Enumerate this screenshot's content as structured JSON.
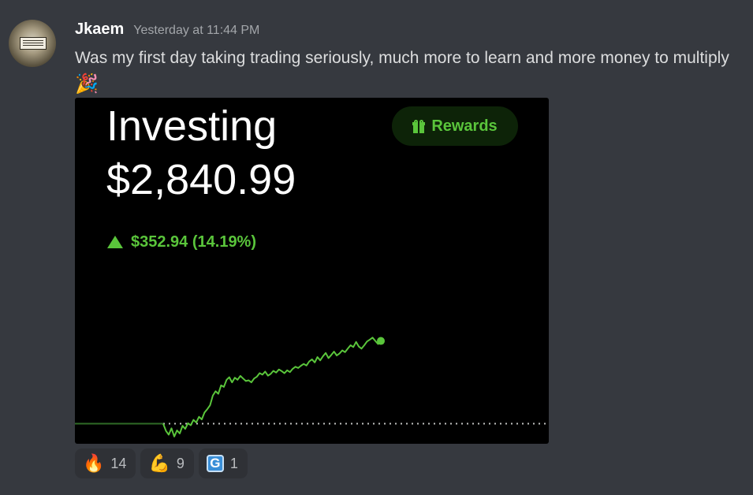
{
  "message": {
    "username": "Jkaem",
    "timestamp": "Yesterday at 11:44 PM",
    "text": "Was my first day taking trading seriously, much more to learn and more money to multiply",
    "emoji": "🎉"
  },
  "attachment": {
    "title": "Investing",
    "value": "$2,840.99",
    "change": "$352.94 (14.19%)",
    "rewards_label": "Rewards",
    "accent_color": "#5ac53b"
  },
  "chart_data": {
    "type": "line",
    "title": "",
    "xlabel": "",
    "ylabel": "",
    "baseline": 2488.05,
    "ylim": [
      2425,
      2900
    ],
    "x": [
      0,
      1,
      2,
      3,
      4,
      5,
      6,
      7,
      8,
      9,
      10,
      11,
      12,
      13,
      14,
      15,
      16,
      17,
      18,
      19,
      20,
      21,
      22,
      23,
      24,
      25,
      26,
      27,
      28,
      29,
      30,
      31,
      32,
      33,
      34,
      35,
      36,
      37,
      38,
      39,
      40,
      41,
      42,
      43,
      44,
      45,
      46,
      47,
      48,
      49,
      50,
      51,
      52,
      53,
      54,
      55,
      56,
      57,
      58,
      59,
      60,
      61,
      62,
      63,
      64,
      65,
      66,
      67,
      68,
      69,
      70,
      71,
      72,
      73,
      74,
      75,
      76,
      77,
      78,
      79
    ],
    "series": [
      {
        "values": [
          2488,
          2460,
          2445,
          2470,
          2438,
          2462,
          2450,
          2480,
          2468,
          2490,
          2482,
          2503,
          2493,
          2515,
          2505,
          2532,
          2545,
          2560,
          2598,
          2615,
          2605,
          2638,
          2632,
          2660,
          2670,
          2650,
          2668,
          2660,
          2675,
          2665,
          2655,
          2658,
          2650,
          2665,
          2672,
          2686,
          2680,
          2692,
          2676,
          2683,
          2695,
          2688,
          2700,
          2694,
          2686,
          2697,
          2690,
          2703,
          2711,
          2706,
          2715,
          2722,
          2716,
          2732,
          2740,
          2728,
          2749,
          2736,
          2752,
          2765,
          2745,
          2757,
          2770,
          2755,
          2763,
          2775,
          2768,
          2782,
          2795,
          2788,
          2808,
          2790,
          2782,
          2795,
          2810,
          2817,
          2825,
          2812,
          2800,
          2812
        ]
      }
    ]
  },
  "reactions": [
    {
      "emoji": "🔥",
      "count": "14"
    },
    {
      "emoji": "💪",
      "count": "9"
    },
    {
      "emoji": "G",
      "count": "1"
    }
  ]
}
